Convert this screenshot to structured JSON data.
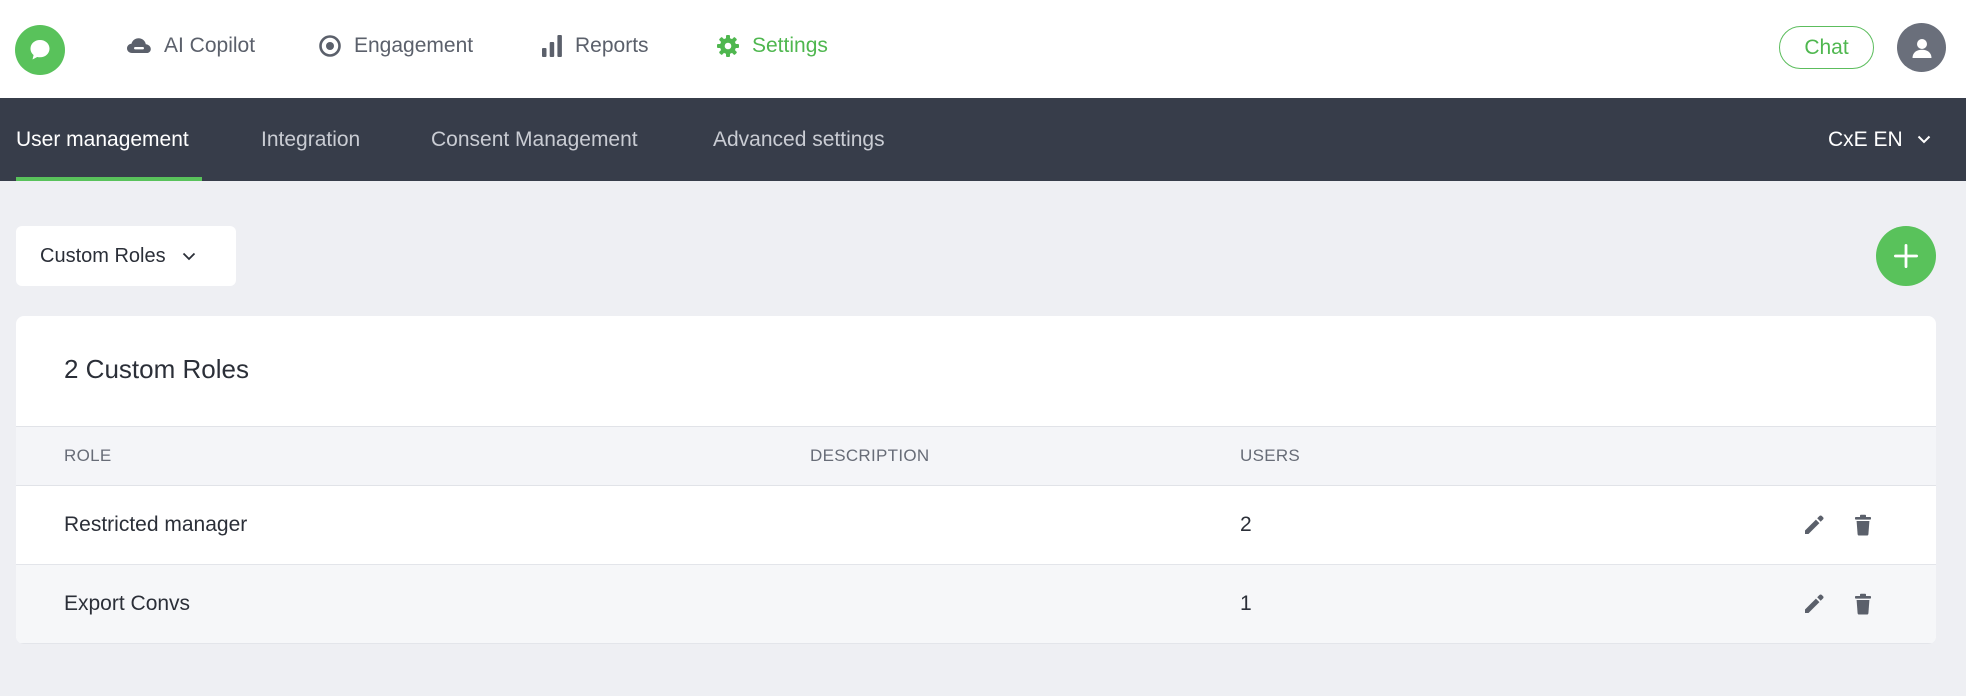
{
  "topnav": {
    "items": [
      {
        "label": "AI Copilot",
        "icon": "cloud-icon"
      },
      {
        "label": "Engagement",
        "icon": "target-icon"
      },
      {
        "label": "Reports",
        "icon": "bar-chart-icon"
      },
      {
        "label": "Settings",
        "icon": "gear-icon",
        "active": true
      }
    ],
    "chat_label": "Chat"
  },
  "subnav": {
    "items": [
      {
        "label": "User management",
        "active": true
      },
      {
        "label": "Integration"
      },
      {
        "label": "Consent Management"
      },
      {
        "label": "Advanced settings"
      }
    ],
    "language": "CxE EN"
  },
  "filter": {
    "selected": "Custom Roles"
  },
  "roles_card": {
    "title": "2 Custom Roles",
    "columns": [
      "ROLE",
      "DESCRIPTION",
      "USERS"
    ],
    "rows": [
      {
        "role": "Restricted manager",
        "description": "",
        "users": "2"
      },
      {
        "role": "Export Convs",
        "description": "",
        "users": "1"
      }
    ]
  },
  "colors": {
    "brand_green": "#59c25b",
    "subnav_bg": "#373d4a",
    "page_bg": "#eeeff3"
  }
}
